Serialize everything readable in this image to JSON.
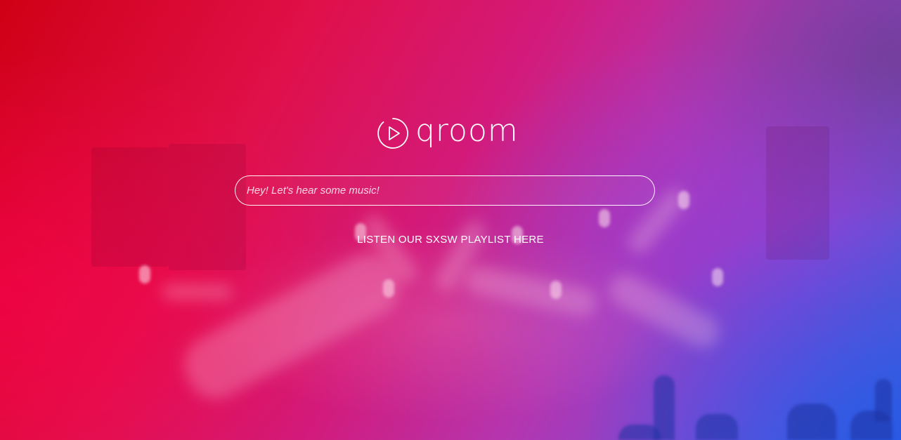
{
  "brand": {
    "name": "qroom",
    "icon": "play-circle-icon"
  },
  "search": {
    "placeholder": "Hey! Let's hear some music!",
    "value": ""
  },
  "playlist_link": {
    "label": "LISTEN OUR SXSW PLAYLIST HERE"
  },
  "colors": {
    "background_start": "#cf0015",
    "background_mid": "#d31a7a",
    "background_end": "#3f5fd6",
    "foreground": "#ffffff"
  }
}
